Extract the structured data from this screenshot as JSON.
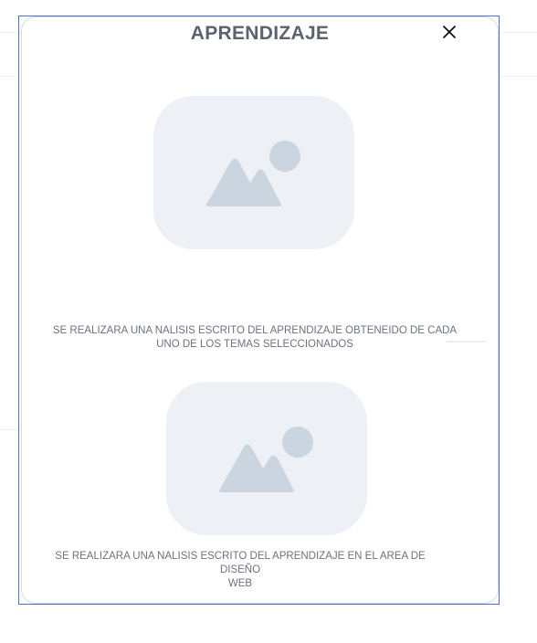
{
  "modal": {
    "title": "APRENDIZAJE",
    "close_icon": "close-icon"
  },
  "items": [
    {
      "image_icon": "image-placeholder-icon",
      "caption_line1": "SE REALIZARA UNA NALISIS ESCRITO DEL APRENDIZAJE OBTENEIDO DE CADA",
      "caption_line2": "UNO DE LOS TEMAS SELECCIONADOS"
    },
    {
      "image_icon": "image-placeholder-icon",
      "caption_line1": "SE REALIZARA UNA NALISIS ESCRITO DEL APRENDIZAJE EN EL AREA DE DISEÑO",
      "caption_line2": "WEB"
    }
  ],
  "colors": {
    "accent_border": "#4a72c9",
    "placeholder_bg": "#edf0f4",
    "placeholder_icon": "#cbd5df",
    "title_text": "#5b6270"
  }
}
